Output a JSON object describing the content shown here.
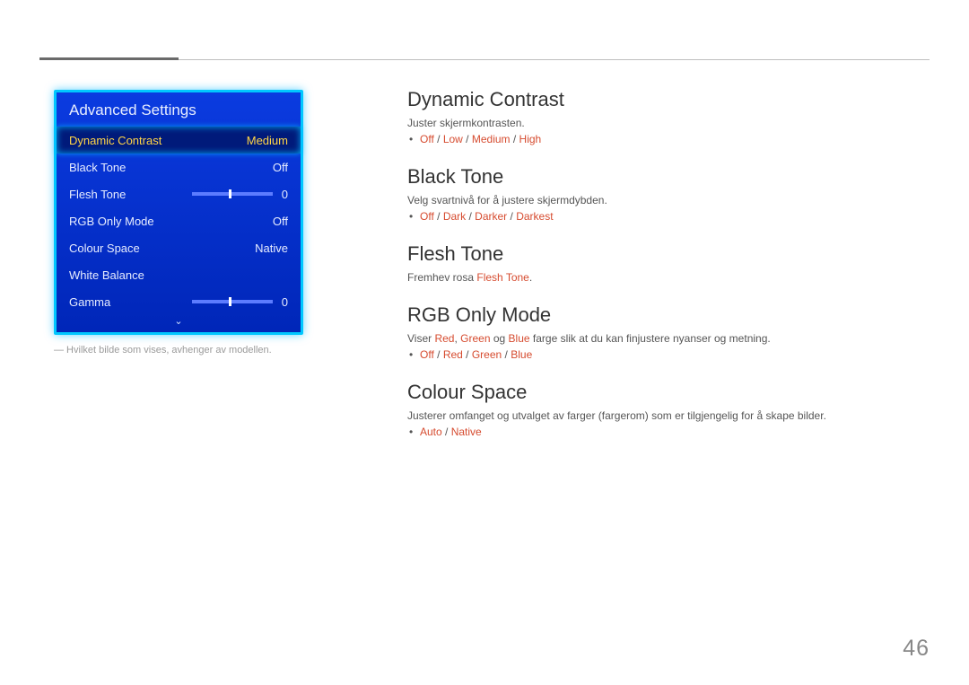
{
  "pageNumber": "46",
  "panel": {
    "title": "Advanced Settings",
    "items": [
      {
        "label": "Dynamic Contrast",
        "value": "Medium",
        "slider": false,
        "selected": true
      },
      {
        "label": "Black Tone",
        "value": "Off",
        "slider": false,
        "selected": false
      },
      {
        "label": "Flesh Tone",
        "value": "0",
        "slider": true,
        "selected": false
      },
      {
        "label": "RGB Only Mode",
        "value": "Off",
        "slider": false,
        "selected": false
      },
      {
        "label": "Colour Space",
        "value": "Native",
        "slider": false,
        "selected": false
      },
      {
        "label": "White Balance",
        "value": "",
        "slider": false,
        "selected": false
      },
      {
        "label": "Gamma",
        "value": "0",
        "slider": true,
        "selected": false
      }
    ],
    "note": "― Hvilket bilde som vises, avhenger av modellen."
  },
  "sections": {
    "dynamicContrast": {
      "title": "Dynamic Contrast",
      "desc": "Juster skjermkontrasten.",
      "opts": [
        "Off",
        "Low",
        "Medium",
        "High"
      ]
    },
    "blackTone": {
      "title": "Black Tone",
      "desc": "Velg svartnivå for å justere skjermdybden.",
      "opts": [
        "Off",
        "Dark",
        "Darker",
        "Darkest"
      ]
    },
    "fleshTone": {
      "title": "Flesh Tone",
      "pre": "Fremhev rosa ",
      "hl": "Flesh Tone",
      "post": "."
    },
    "rgbOnly": {
      "title": "RGB Only Mode",
      "pre": "Viser ",
      "red": "Red",
      "green": "Green",
      "blue": "Blue",
      "sep1": ", ",
      "sep2": " og ",
      "post": " farge slik at du kan finjustere nyanser og metning.",
      "opts": [
        "Off",
        "Red",
        "Green",
        "Blue"
      ]
    },
    "colourSpace": {
      "title": "Colour Space",
      "desc": "Justerer omfanget og utvalget av farger (fargerom) som er tilgjengelig for å skape bilder.",
      "opts": [
        "Auto",
        "Native"
      ]
    }
  }
}
